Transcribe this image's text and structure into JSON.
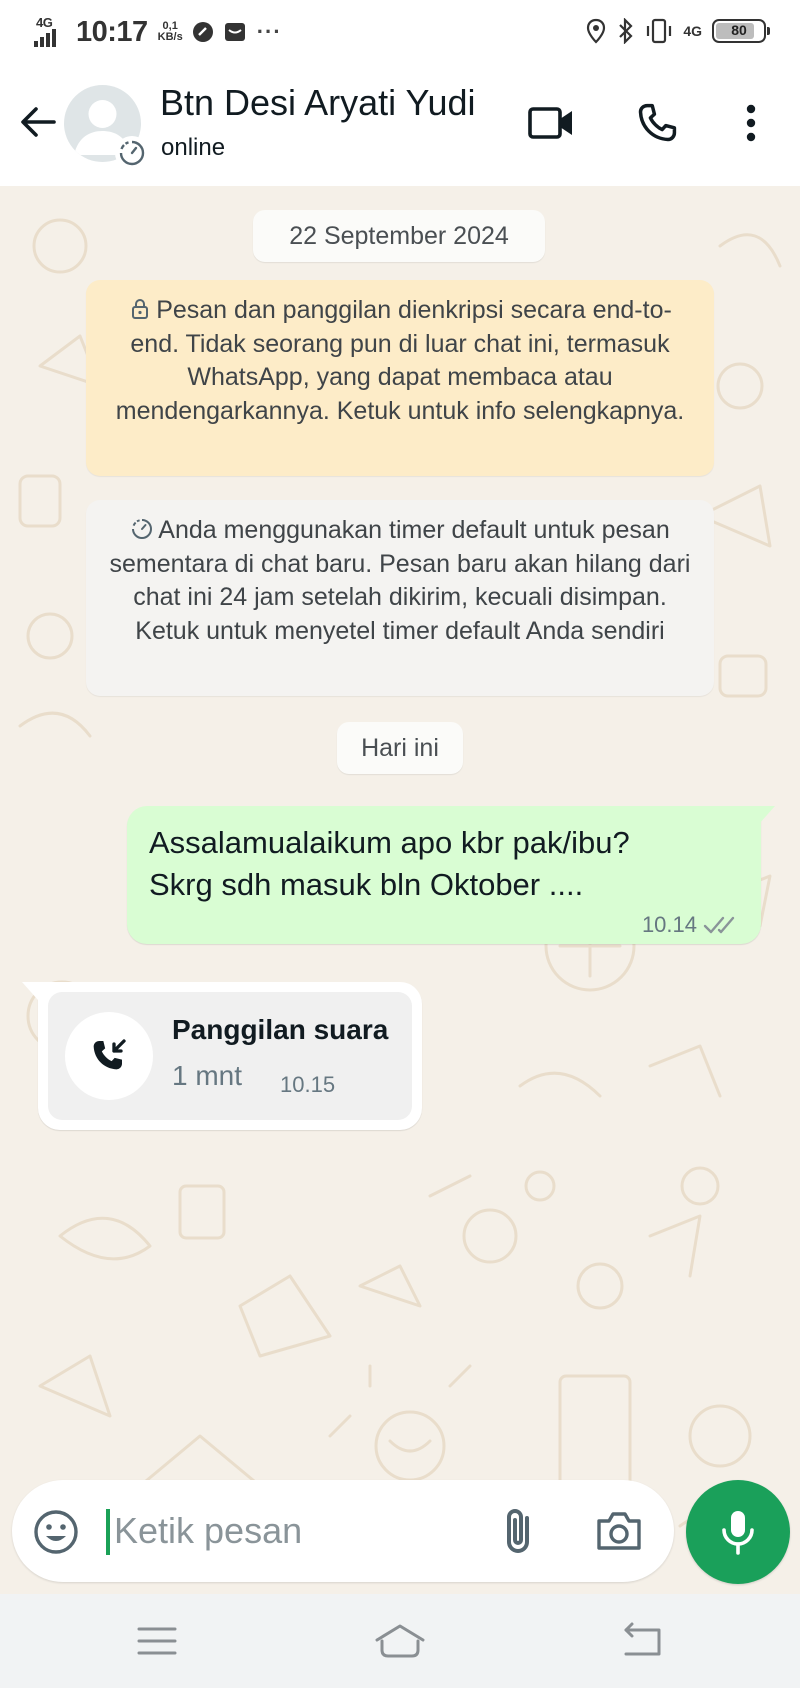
{
  "status_bar": {
    "network_label": "4G",
    "time": "10:17",
    "speed_value": "0,1",
    "speed_unit": "KB/s",
    "more": "···",
    "right_network": "4G",
    "battery": "80"
  },
  "header": {
    "contact_name": "Btn Desi Aryati Yudi",
    "status": "online"
  },
  "chat": {
    "date_chip": "22 September 2024",
    "encryption_notice": "Pesan dan panggilan dienkripsi secara end-to-end. Tidak seorang pun di luar chat ini, termasuk WhatsApp, yang dapat membaca atau mendengarkannya. Ketuk untuk info selengkapnya.",
    "timer_notice": "Anda menggunakan timer default untuk pesan sementara di chat baru. Pesan baru akan hilang dari chat ini 24 jam setelah dikirim, kecuali disimpan. Ketuk untuk menyetel timer default Anda sendiri",
    "today_chip": "Hari ini",
    "messages": [
      {
        "direction": "outgoing",
        "line1": "Assalamualaikum apo kbr pak/ibu?",
        "line2": "Skrg sdh masuk bln Oktober ....",
        "time": "10.14",
        "status_icon": "double-check-icon"
      },
      {
        "direction": "incoming",
        "type": "voice-call",
        "title": "Panggilan suara",
        "duration": "1 mnt",
        "time": "10.15",
        "icon": "incoming-call-icon"
      }
    ]
  },
  "input_bar": {
    "placeholder": "Ketik pesan"
  },
  "colors": {
    "accent_green": "#1aa05a",
    "outgoing_bubble": "#d9fdd3",
    "encryption_notice_bg": "#fdecc8",
    "chat_background": "#f5f0e8"
  }
}
